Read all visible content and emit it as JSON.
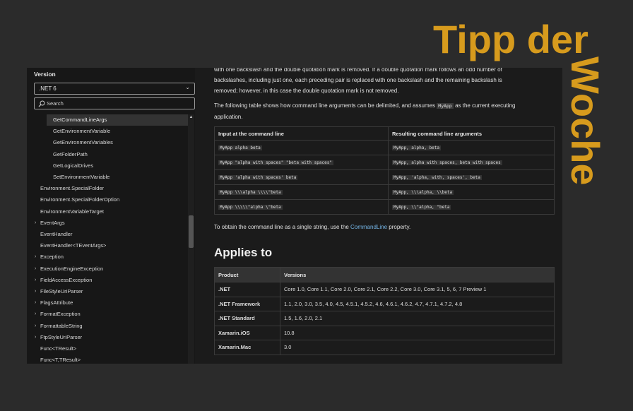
{
  "sidebar": {
    "version_label": "Version",
    "version_value": ".NET 6",
    "search_placeholder": "Search",
    "items": [
      {
        "label": "GetCommandLineArgs",
        "indent": 2,
        "selected": true
      },
      {
        "label": "GetEnvironmentVariable",
        "indent": 2
      },
      {
        "label": "GetEnvironmentVariables",
        "indent": 2
      },
      {
        "label": "GetFolderPath",
        "indent": 2
      },
      {
        "label": "GetLogicalDrives",
        "indent": 2
      },
      {
        "label": "SetEnvironmentVariable",
        "indent": 2
      },
      {
        "label": "Environment.SpecialFolder",
        "indent": 1
      },
      {
        "label": "Environment.SpecialFolderOption",
        "indent": 1
      },
      {
        "label": "EnvironmentVariableTarget",
        "indent": 1
      },
      {
        "label": "EventArgs",
        "indent": 1,
        "expandable": true
      },
      {
        "label": "EventHandler",
        "indent": 1
      },
      {
        "label": "EventHandler<TEventArgs>",
        "indent": 1
      },
      {
        "label": "Exception",
        "indent": 1,
        "expandable": true
      },
      {
        "label": "ExecutionEngineException",
        "indent": 1,
        "expandable": true
      },
      {
        "label": "FieldAccessException",
        "indent": 1,
        "expandable": true
      },
      {
        "label": "FileStyleUriParser",
        "indent": 1,
        "expandable": true
      },
      {
        "label": "FlagsAttribute",
        "indent": 1,
        "expandable": true
      },
      {
        "label": "FormatException",
        "indent": 1,
        "expandable": true
      },
      {
        "label": "FormattableString",
        "indent": 1,
        "expandable": true
      },
      {
        "label": "FtpStyleUriParser",
        "indent": 1,
        "expandable": true
      },
      {
        "label": "Func<TResult>",
        "indent": 1
      },
      {
        "label": "Func<T,TResult>",
        "indent": 1
      }
    ]
  },
  "content": {
    "intro_line1": "with one backslash and the double quotation mark is removed. If a double quotation mark follows an odd number of",
    "intro_line2": "backslashes, including just one, each preceding pair is replaced with one backslash and the remaining backslash is",
    "intro_line3": "removed; however, in this case the double quotation mark is not removed.",
    "table_intro_a": "The following table shows how command line arguments can be delimited, and assumes ",
    "table_intro_code": "MyApp",
    "table_intro_b": " as the current executing",
    "table_intro_c": "application.",
    "cmd_table": {
      "headers": [
        "Input at the command line",
        "Resulting command line arguments"
      ],
      "rows": [
        [
          "MyApp alpha beta",
          "MyApp, alpha, beta"
        ],
        [
          "MyApp \"alpha with spaces\" \"beta with spaces\"",
          "MyApp, alpha with spaces, beta with spaces"
        ],
        [
          "MyApp 'alpha with spaces' beta",
          "MyApp, 'alpha, with, spaces', beta"
        ],
        [
          "MyApp \\\\\\alpha \\\\\\\\\"beta",
          "MyApp, \\\\\\alpha, \\\\beta"
        ],
        [
          "MyApp \\\\\\\\\\\"alpha \\\"beta",
          "MyApp, \\\\\"alpha, \"beta"
        ]
      ]
    },
    "obtain_a": "To obtain the command line as a single string, use the ",
    "obtain_link": "CommandLine",
    "obtain_b": " property.",
    "applies_heading": "Applies to",
    "ver_table": {
      "headers": [
        "Product",
        "Versions"
      ],
      "rows": [
        [
          ".NET",
          "Core 1.0, Core 1.1, Core 2.0, Core 2.1, Core 2.2, Core 3.0, Core 3.1, 5, 6, 7 Preview 1"
        ],
        [
          ".NET Framework",
          "1.1, 2.0, 3.0, 3.5, 4.0, 4.5, 4.5.1, 4.5.2, 4.6, 4.6.1, 4.6.2, 4.7, 4.7.1, 4.7.2, 4.8"
        ],
        [
          ".NET Standard",
          "1.5, 1.6, 2.0, 2.1"
        ],
        [
          "Xamarin.iOS",
          "10.8"
        ],
        [
          "Xamarin.Mac",
          "3.0"
        ]
      ]
    }
  },
  "overlay": {
    "tipp": "Tipp der",
    "woche": "Woche",
    "color": "#d79b1d"
  }
}
